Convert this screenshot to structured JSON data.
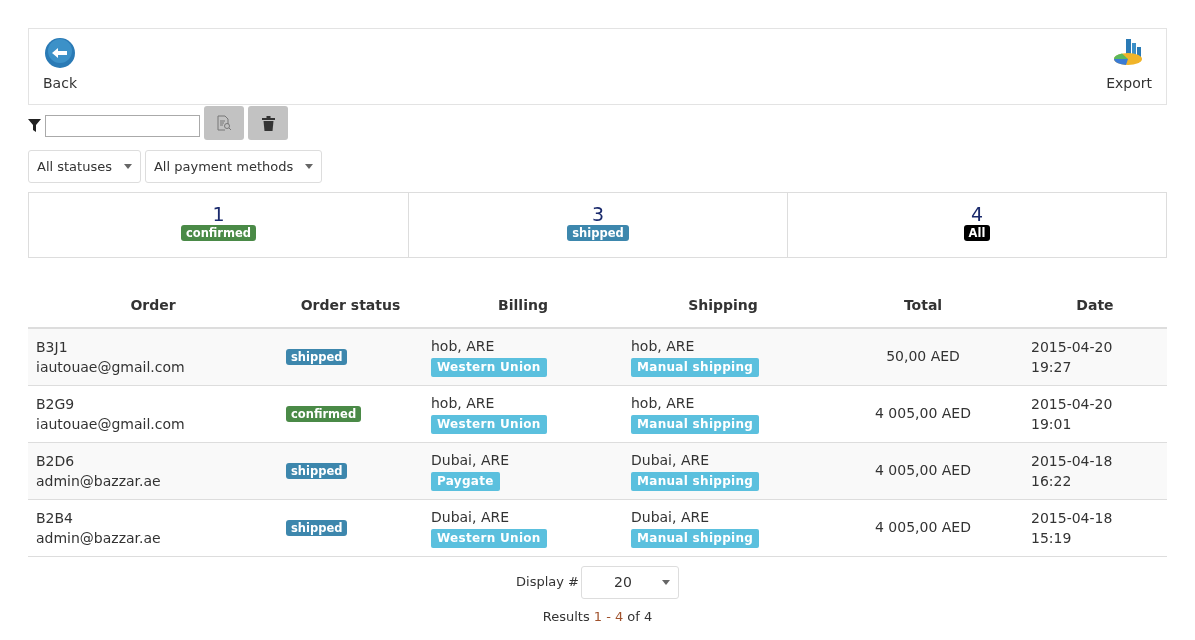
{
  "toolbar": {
    "back": "Back",
    "export": "Export"
  },
  "selects": [
    {
      "value": "All statuses"
    },
    {
      "value": "All payment methods"
    }
  ],
  "stats": [
    {
      "count": "1",
      "label": "confirmed",
      "color": "#4a8a47"
    },
    {
      "count": "3",
      "label": "shipped",
      "color": "#3d87ad"
    },
    {
      "count": "4",
      "label": "All",
      "color": "#000000"
    }
  ],
  "table": {
    "columns": [
      "Order",
      "Order status",
      "Billing",
      "Shipping",
      "Total",
      "Date"
    ],
    "rows": [
      {
        "order": "B3J1",
        "email": "iautouae@gmail.com",
        "status": {
          "label": "shipped",
          "color": "#3d87ad"
        },
        "billing": "hob, ARE",
        "payment": "Western Union",
        "shipping": "hob, ARE",
        "shipping_method": "Manual shipping",
        "total": "50,00 AED",
        "date": "2015-04-20",
        "time": "19:27"
      },
      {
        "order": "B2G9",
        "email": "iautouae@gmail.com",
        "status": {
          "label": "confirmed",
          "color": "#4a8a47"
        },
        "billing": "hob, ARE",
        "payment": "Western Union",
        "shipping": "hob, ARE",
        "shipping_method": "Manual shipping",
        "total": "4 005,00 AED",
        "date": "2015-04-20",
        "time": "19:01"
      },
      {
        "order": "B2D6",
        "email": "admin@bazzar.ae",
        "status": {
          "label": "shipped",
          "color": "#3d87ad"
        },
        "billing": "Dubai, ARE",
        "payment": "Paygate",
        "shipping": "Dubai, ARE",
        "shipping_method": "Manual shipping",
        "total": "4 005,00 AED",
        "date": "2015-04-18",
        "time": "16:22"
      },
      {
        "order": "B2B4",
        "email": "admin@bazzar.ae",
        "status": {
          "label": "shipped",
          "color": "#3d87ad"
        },
        "billing": "Dubai, ARE",
        "payment": "Western Union",
        "shipping": "Dubai, ARE",
        "shipping_method": "Manual shipping",
        "total": "4 005,00 AED",
        "date": "2015-04-18",
        "time": "15:19"
      }
    ]
  },
  "pagination": {
    "label": "Display #",
    "value": "20",
    "results_label": "Results",
    "range": "1 - 4",
    "of": "of 4"
  }
}
